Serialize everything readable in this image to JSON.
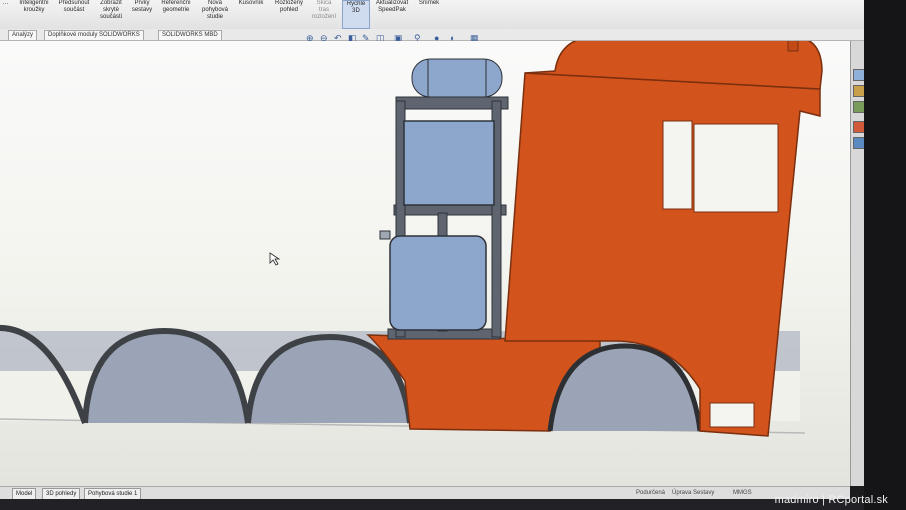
{
  "ribbon": {
    "buttons": [
      {
        "label": "Inteligentní\nkroužky",
        "name": "ribbon-smart-rings-button"
      },
      {
        "label": "Předsunout\nsoučást",
        "name": "ribbon-move-component-button"
      },
      {
        "label": "Zobrazit\nskryté\nsoučásti",
        "name": "ribbon-show-hidden-button"
      },
      {
        "label": "Prvky\nsestavy",
        "name": "ribbon-assembly-features-button"
      },
      {
        "label": "Referenční\ngeometrie",
        "name": "ribbon-reference-geometry-button"
      },
      {
        "label": "Nová\npohybová\nstudie",
        "name": "ribbon-new-motion-study-button"
      },
      {
        "label": "Kusovník",
        "name": "ribbon-bom-button"
      },
      {
        "label": "Rozložený\npohled",
        "name": "ribbon-exploded-view-button"
      },
      {
        "label": "Skica\ntras\nrozložení",
        "name": "ribbon-explode-line-sketch-button"
      },
      {
        "label": "Rychlé\n3D",
        "name": "ribbon-instant3d-button"
      },
      {
        "label": "Aktualizovat\nSpeedPak",
        "name": "ribbon-update-speedpak-button"
      },
      {
        "label": "Snímek",
        "name": "ribbon-snapshot-button"
      }
    ]
  },
  "tabs": [
    {
      "label": "Analýzy"
    },
    {
      "label": "Doplňkové moduly SOLIDWORKS"
    },
    {
      "label": "SOLIDWORKS MBD"
    }
  ],
  "status_tabs": [
    {
      "label": "Model"
    },
    {
      "label": "3D pohledy"
    },
    {
      "label": "Pohybová studie 1"
    }
  ],
  "status_fields": [
    "Podurčená",
    "Úprava Sestavy",
    "MMGS"
  ],
  "watermark": "madmiro | RCportal.sk",
  "colors": {
    "body_orange": "#d2531c",
    "frame_grey": "#5e6570",
    "glass_blue": "#8da6cc",
    "accent": "#3b5f9a"
  }
}
